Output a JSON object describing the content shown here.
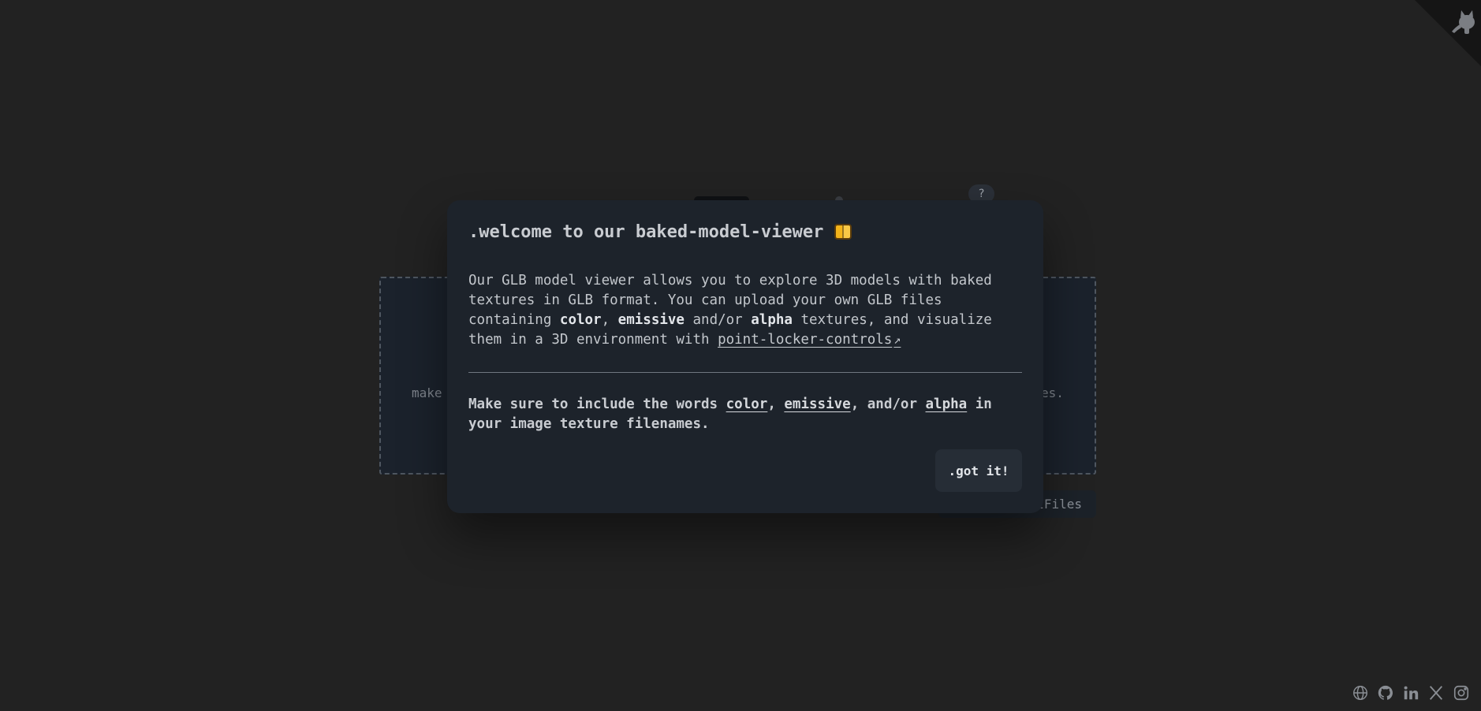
{
  "background": {
    "help_label": "?",
    "dropzone_left_text": "make",
    "dropzone_right_text": "es.",
    "files_button_label": "lFiles"
  },
  "modal": {
    "title": ".welcome to our baked-model-viewer",
    "title_emoji": "book-emoji-icon",
    "body_part1": "Our GLB model viewer allows you to explore 3D models with baked textures in GLB format. You can upload your own GLB files containing ",
    "kw_color": "color",
    "sep1": ", ",
    "kw_emissive": "emissive",
    "sep2": " and/or ",
    "kw_alpha": "alpha",
    "body_part2": " textures, and visualize them in a 3D environment with ",
    "link_label": "point-locker-controls",
    "link_arrow": "↗",
    "note_part1": "Make sure to include the words ",
    "note_kw_color": "color",
    "note_sep1": ", ",
    "note_kw_emissive": "emissive",
    "note_sep2": ", and/or ",
    "note_kw_alpha": "alpha",
    "note_part2": " in your image texture filenames.",
    "confirm_label": ".got it!"
  },
  "colors": {
    "page_bg": "#222222",
    "modal_bg": "#1d232b",
    "accent": "#f4b41a"
  },
  "social": [
    "globe-icon",
    "github-icon",
    "linkedin-icon",
    "x-icon",
    "instagram-icon"
  ]
}
